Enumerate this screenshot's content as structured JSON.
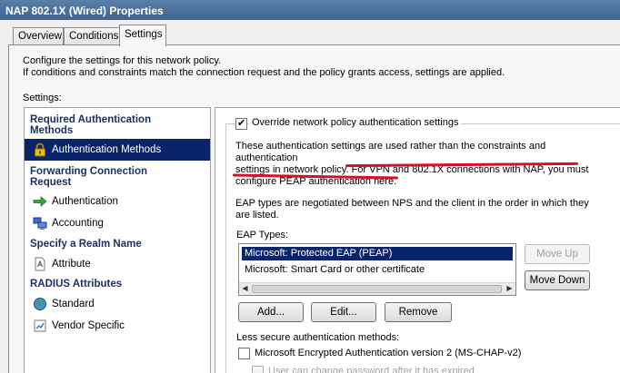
{
  "window": {
    "title": "NAP 802.1X (Wired) Properties"
  },
  "tabs": [
    {
      "label": "Overview"
    },
    {
      "label": "Conditions"
    },
    {
      "label": "Settings"
    }
  ],
  "intro": {
    "line1": "Configure the settings for this network policy.",
    "line2": "If conditions and constraints match the connection request and the policy grants access, settings are applied."
  },
  "settings_label": "Settings:",
  "nav": {
    "required_header": "Required Authentication Methods",
    "auth_methods": "Authentication Methods",
    "forwarding_header": "Forwarding Connection Request",
    "authentication": "Authentication",
    "accounting": "Accounting",
    "realm_header": "Specify a Realm Name",
    "attribute": "Attribute",
    "radius_header": "RADIUS Attributes",
    "standard": "Standard",
    "vendor_specific": "Vendor Specific"
  },
  "override": {
    "label": "Override network policy authentication settings",
    "checked": true
  },
  "notice": {
    "line1": "These authentication settings are used rather than the constraints and authentication",
    "line2a": "settings in network policy. ",
    "line2b": "For VPN and 802.1X connections with NAP, you must",
    "line3": "configure PEAP authentication here."
  },
  "eap_info": {
    "line1": "EAP types are negotiated between NPS and the client in the order in which they",
    "line2": "are listed."
  },
  "eap_types_label": "EAP Types:",
  "eap_types": [
    "Microsoft: Protected EAP (PEAP)",
    "Microsoft: Smart Card or other certificate"
  ],
  "buttons": {
    "move_up": "Move Up",
    "move_down": "Move Down",
    "add": "Add...",
    "edit": "Edit...",
    "remove": "Remove"
  },
  "less_secure_label": "Less secure authentication methods:",
  "mschap_v2": "Microsoft Encrypted Authentication version 2 (MS-CHAP-v2)",
  "user_change_pw": "User can change password after it has expired",
  "colors": {
    "accent": "#0a246a",
    "highlight": "#d3102a",
    "title_bar": "#4a6f9c"
  }
}
